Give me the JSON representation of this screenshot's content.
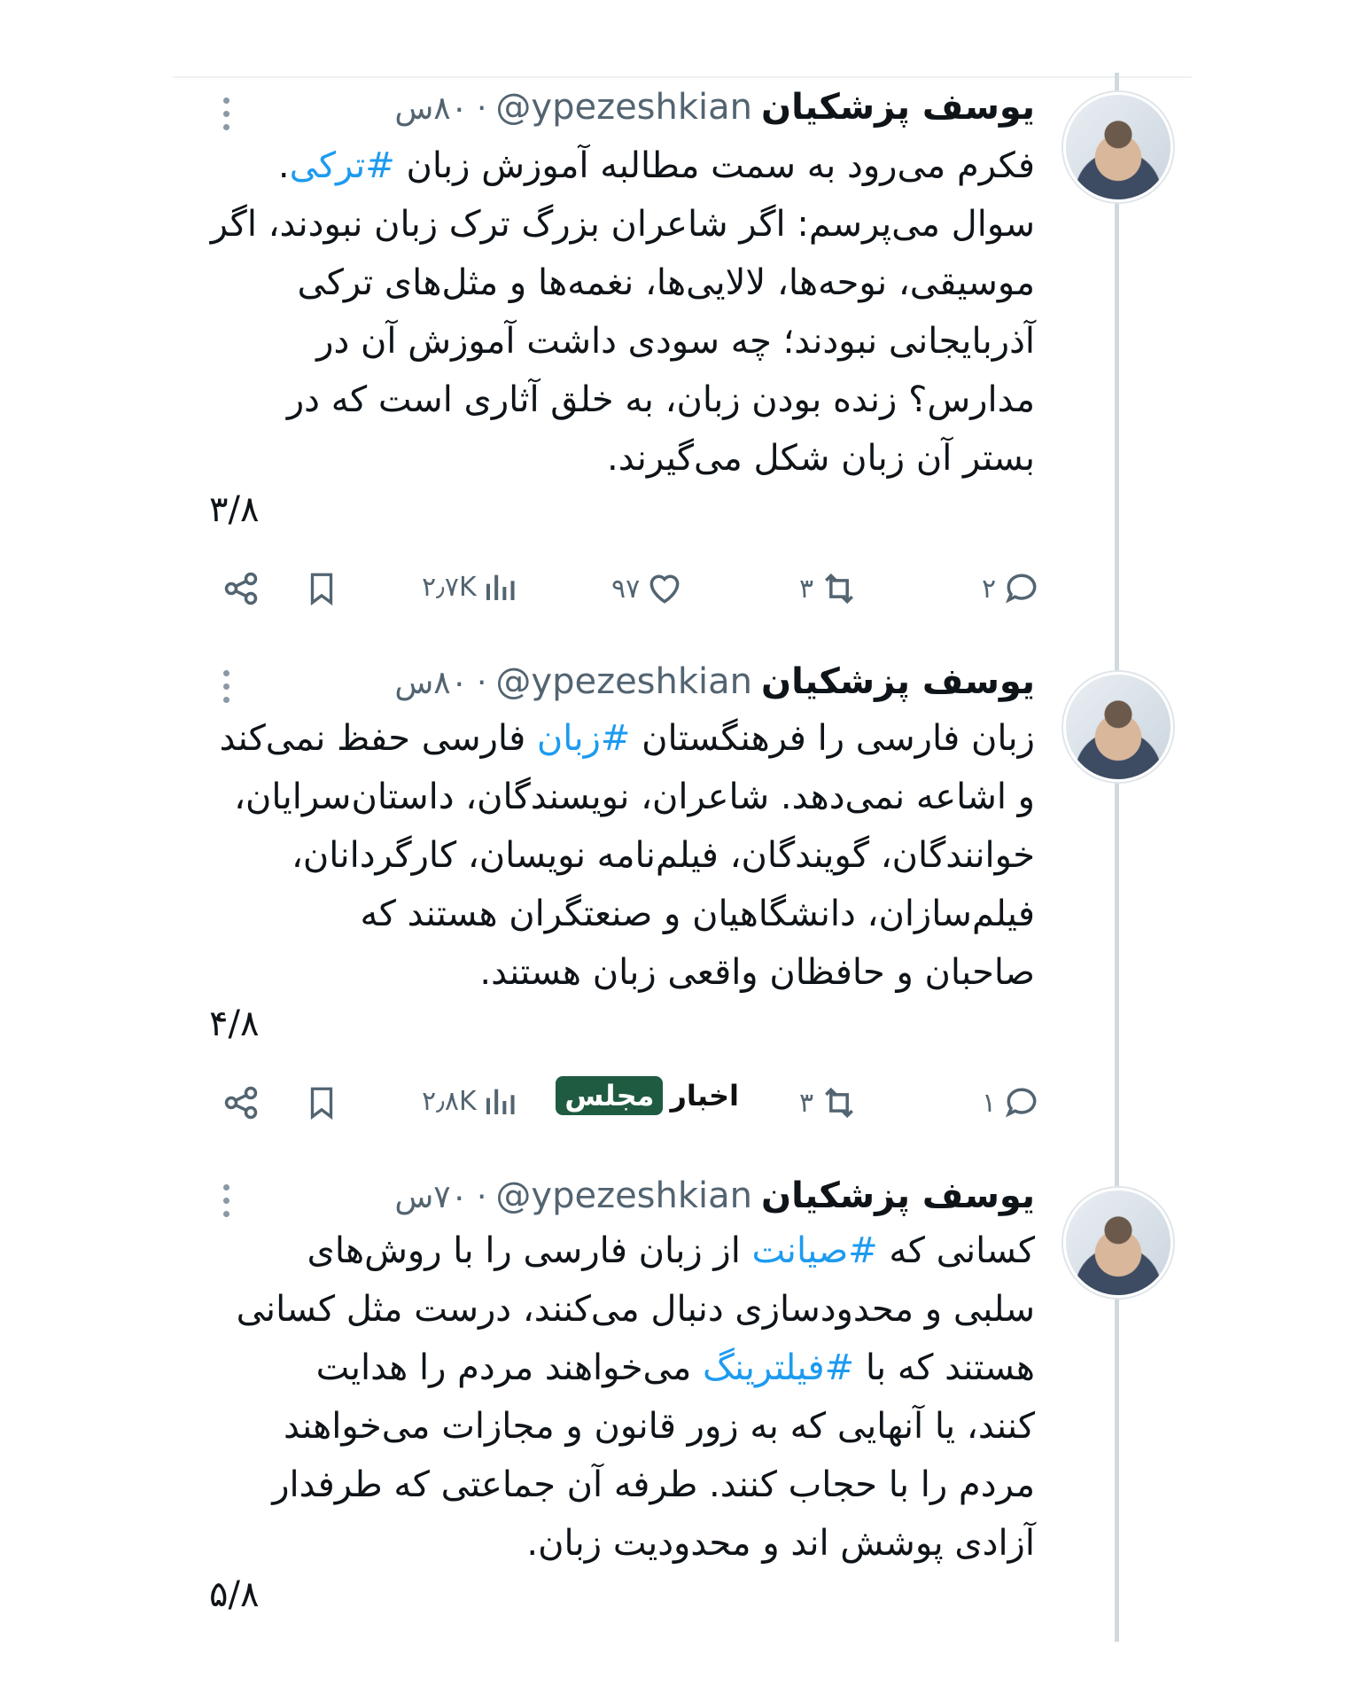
{
  "tweets": [
    {
      "author": "یوسف پزشکیان",
      "handle": "@ypezeshkian",
      "time": "۸۰س",
      "lines": [
        {
          "before": "فکرم می‌رود به سمت مطالبه آموزش زبان ",
          "hashtag": "#ترکی",
          "after": "."
        },
        {
          "before": "سوال می‌پرسم: اگر شاعران بزرگ ترک زبان نبودند، اگر",
          "hashtag": "",
          "after": ""
        },
        {
          "before": "موسیقی، نوحه‌ها، لالایی‌ها، نغمه‌ها و مثل‌های ترکی",
          "hashtag": "",
          "after": ""
        },
        {
          "before": "آذربایجانی نبودند؛ چه سودی داشت آموزش آن در",
          "hashtag": "",
          "after": ""
        },
        {
          "before": "مدارس؟ زنده بودن زبان، به خلق آثاری است که در",
          "hashtag": "",
          "after": ""
        },
        {
          "before": "بستر آن زبان شکل می‌گیرند.",
          "hashtag": "",
          "after": ""
        }
      ],
      "counter": "۳/۸",
      "replies": "۲",
      "retweets": "۳",
      "likes": "۹۷",
      "views": "۲٫۷K"
    },
    {
      "author": "یوسف پزشکیان",
      "handle": "@ypezeshkian",
      "time": "۸۰س",
      "lines": [
        {
          "before": "زبان فارسی را فرهنگستان ",
          "hashtag": "#زبان",
          "after": " فارسی حفظ نمی‌کند"
        },
        {
          "before": "و اشاعه نمی‌دهد. شاعران، نویسندگان، داستان‌سرایان،",
          "hashtag": "",
          "after": ""
        },
        {
          "before": "خوانندگان، گویندگان، فیلم‌نامه نویسان، کارگردانان،",
          "hashtag": "",
          "after": ""
        },
        {
          "before": "فیلم‌سازان، دانشگاهیان و صنعتگران هستند که",
          "hashtag": "",
          "after": ""
        },
        {
          "before": "صاحبان و حافظان واقعی زبان هستند.",
          "hashtag": "",
          "after": ""
        }
      ],
      "counter": "۴/۸",
      "replies": "۱",
      "retweets": "۳",
      "likes": "",
      "views": "۲٫۸K"
    },
    {
      "author": "یوسف پزشکیان",
      "handle": "@ypezeshkian",
      "time": "۷۰س",
      "lines": [
        {
          "before": "کسانی که ",
          "hashtag": "#صیانت",
          "after": " از زبان فارسی را با روش‌های"
        },
        {
          "before": "سلبی و محدودسازی دنبال می‌کنند، درست مثل کسانی",
          "hashtag": "",
          "after": ""
        },
        {
          "before": "هستند که با ",
          "hashtag": "#فیلترینگ",
          "after": " می‌خواهند مردم را هدایت"
        },
        {
          "before": "کنند، یا آنهایی که به زور قانون و مجازات می‌خواهند",
          "hashtag": "",
          "after": ""
        },
        {
          "before": "مردم را با حجاب کنند. طرفه آن جماعتی که طرفدار",
          "hashtag": "",
          "after": ""
        },
        {
          "before": "آزادی پوشش اند و محدودیت زبان.",
          "hashtag": "",
          "after": ""
        }
      ],
      "counter": "۵/۸",
      "replies": "",
      "retweets": "",
      "likes": "",
      "views": ""
    }
  ],
  "dot": "·",
  "watermark": {
    "part1": "اخبار",
    "part2": "مجلس"
  },
  "colors": {
    "hashtag": "#1d9bf0",
    "muted": "#536471",
    "thread": "#cfd9de",
    "brand": "#1f5b41"
  },
  "icons": [
    "more-icon",
    "reply-icon",
    "retweet-icon",
    "like-icon",
    "views-icon",
    "bookmark-icon",
    "share-icon"
  ]
}
